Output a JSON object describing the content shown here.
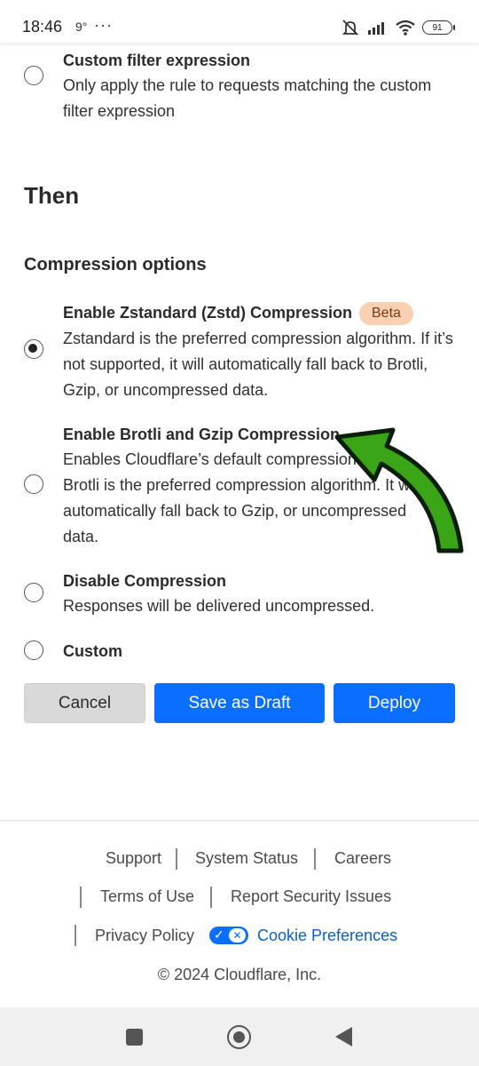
{
  "status_bar": {
    "time": "18:46",
    "temp": "9°",
    "dots": "···",
    "battery": "91"
  },
  "filter_option": {
    "title": "Custom filter expression",
    "description": "Only apply the rule to requests matching the custom filter expression"
  },
  "then_heading": "Then",
  "compression": {
    "heading": "Compression options",
    "options": [
      {
        "title": "Enable Zstandard (Zstd) Compression",
        "badge": "Beta",
        "description": "Zstandard is the preferred compression algorithm. If it’s not supported, it will automatically fall back to Brotli, Gzip, or uncompressed data.",
        "selected": true
      },
      {
        "title": "Enable Brotli and Gzip Compression",
        "description": "Enables Cloudflare’s default compression setting. Brotli is the preferred compression algorithm. It will automatically fall back to Gzip, or uncompressed data.",
        "selected": false
      },
      {
        "title": "Disable Compression",
        "description": "Responses will be delivered uncompressed.",
        "selected": false
      },
      {
        "title": "Custom",
        "selected": false
      }
    ]
  },
  "actions": {
    "cancel": "Cancel",
    "save_draft": "Save as Draft",
    "deploy": "Deploy"
  },
  "footer": {
    "support": "Support",
    "system_status": "System Status",
    "careers": "Careers",
    "terms": "Terms of Use",
    "report_security": "Report Security Issues",
    "privacy": "Privacy Policy",
    "cookie_prefs": "Cookie Preferences",
    "copyright": "© 2024 Cloudflare, Inc."
  },
  "colors": {
    "primary_button": "#0a6fff",
    "beta_badge": "#f8d1b3",
    "annotation_arrow": "#3aa617"
  }
}
